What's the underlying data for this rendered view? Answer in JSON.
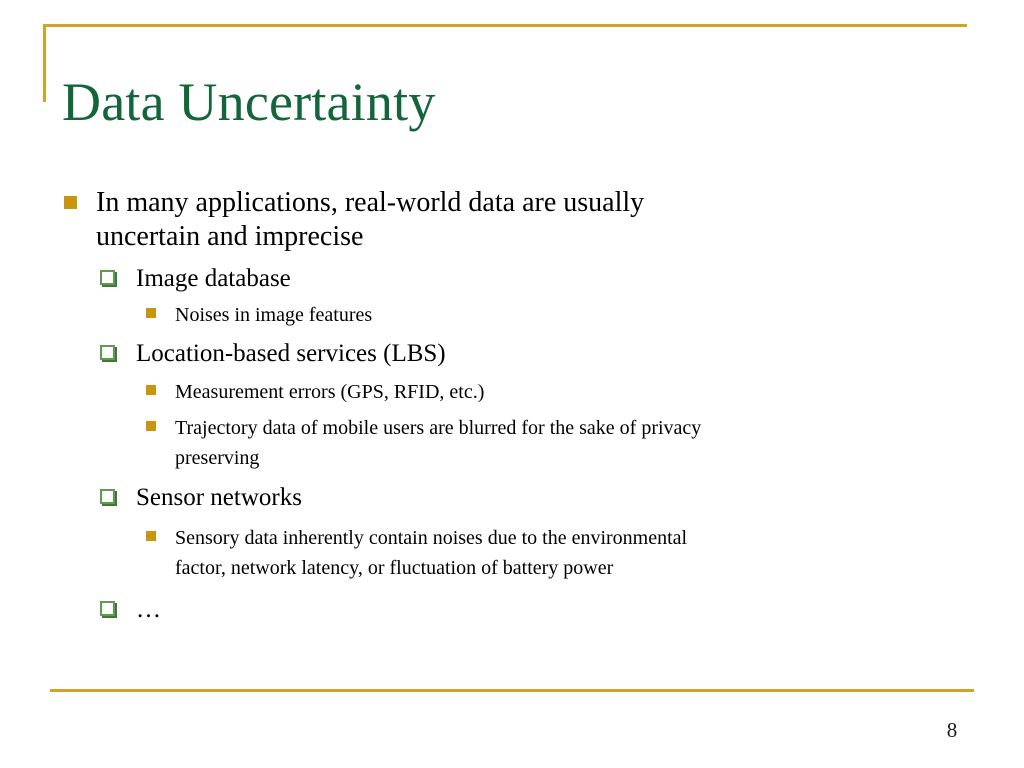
{
  "slide": {
    "title": "Data Uncertainty",
    "page_number": "8",
    "colors": {
      "title": "#14653a",
      "rule": "#d1a32a",
      "bullet_level1": "#c8950f",
      "bullet_level2_border": "#5e9a52",
      "bullet_level2_shadow": "#3d7a33",
      "bullet_level3": "#c8950f",
      "body_text": "#000000",
      "background": "#ffffff"
    },
    "bullets": [
      {
        "level": 1,
        "bullet_icon": "filled-square-bullet",
        "lines": [
          "In   many   applications,   real-world   data   are   usually",
          "uncertain and imprecise"
        ],
        "text": "In many applications, real-world data are usually uncertain and imprecise"
      },
      {
        "level": 2,
        "bullet_icon": "hollow-square-bullet",
        "lines": [
          "Image database"
        ],
        "text": "Image database"
      },
      {
        "level": 3,
        "bullet_icon": "small-filled-square-bullet",
        "lines": [
          "Noises in image features"
        ],
        "text": "Noises in image features"
      },
      {
        "level": 2,
        "bullet_icon": "hollow-square-bullet",
        "lines": [
          "Location-based services (LBS)"
        ],
        "text": "Location-based services (LBS)"
      },
      {
        "level": 3,
        "bullet_icon": "small-filled-square-bullet",
        "lines": [
          "Measurement errors (GPS, RFID, etc.)"
        ],
        "text": "Measurement errors (GPS, RFID, etc.)"
      },
      {
        "level": 3,
        "bullet_icon": "small-filled-square-bullet",
        "lines": [
          "Trajectory  data  of  mobile  users  are  blurred  for  the  sake  of  privacy",
          "preserving"
        ],
        "text": "Trajectory data of mobile users are blurred for the sake of privacy preserving"
      },
      {
        "level": 2,
        "bullet_icon": "hollow-square-bullet",
        "lines": [
          "Sensor networks"
        ],
        "text": "Sensor networks"
      },
      {
        "level": 3,
        "bullet_icon": "small-filled-square-bullet",
        "lines": [
          "Sensory  data  inherently  contain  noises  due  to  the  environmental",
          "factor, network latency, or fluctuation of battery power"
        ],
        "text": "Sensory data inherently contain noises due to the environmental factor, network latency, or fluctuation of battery power"
      },
      {
        "level": 2,
        "bullet_icon": "hollow-square-bullet",
        "lines": [
          "…"
        ],
        "text": "…"
      }
    ]
  }
}
